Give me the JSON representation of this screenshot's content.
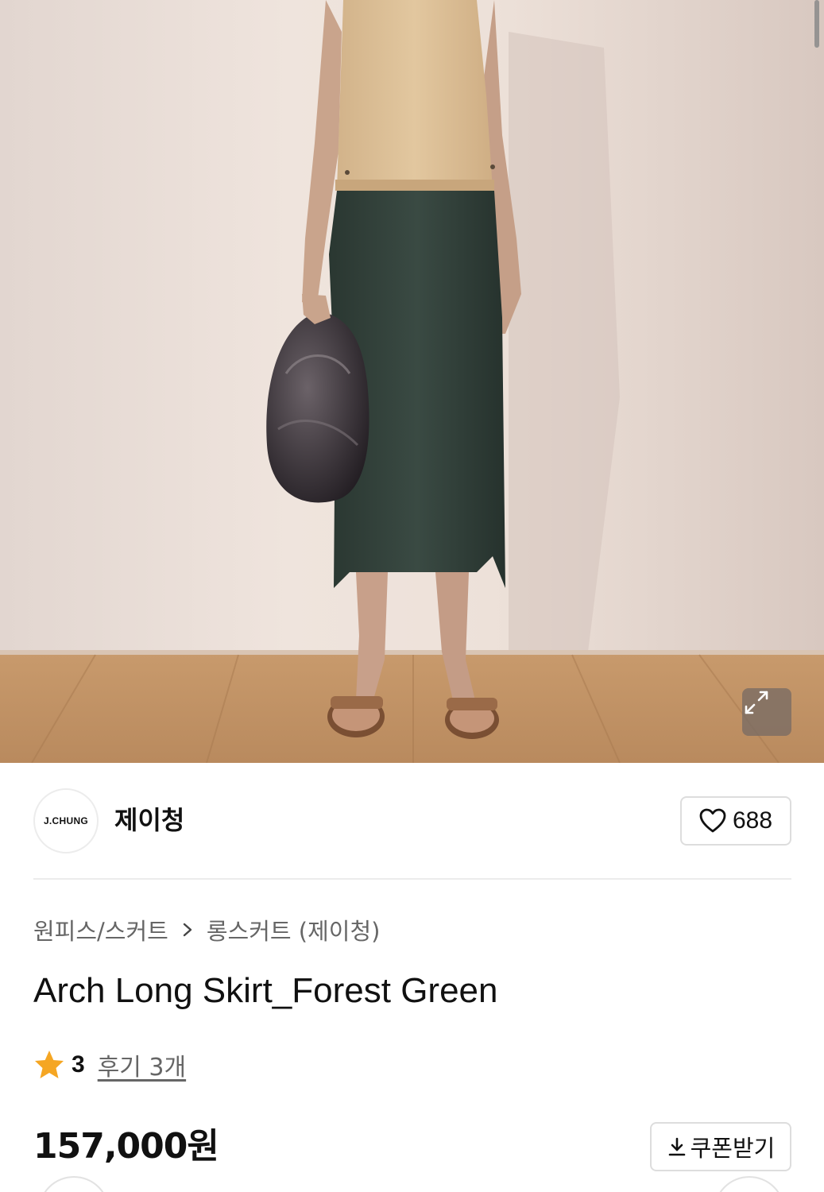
{
  "brand": {
    "logo_text": "J.CHUNG",
    "name": "제이청"
  },
  "like": {
    "icon": "heart-icon",
    "count": "688"
  },
  "breadcrumb": {
    "items": [
      "원피스/스커트",
      "롱스커트 (제이청)"
    ],
    "separator_icon": "chevron-right-icon"
  },
  "product": {
    "title": "Arch Long Skirt_Forest Green",
    "rating": "3",
    "review_text": "후기 3개",
    "price": "157,000원"
  },
  "coupon": {
    "icon": "download-icon",
    "label": "쿠폰받기"
  },
  "image": {
    "expand_icon": "expand-icon"
  },
  "colors": {
    "star": "#f5a623",
    "skirt": "#2f3e38",
    "top": "#d9bd92"
  }
}
